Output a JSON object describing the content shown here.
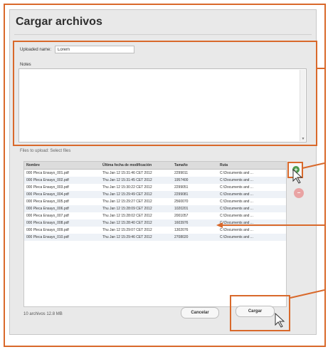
{
  "dialog": {
    "title": "Cargar archivos",
    "upload_label": "Uploaded name:",
    "upload_value": "Lorem",
    "notes_label": "Notes",
    "files_label": "Files to upload: Select files"
  },
  "table": {
    "columns": [
      "Nombre",
      "Última fecha de modificación",
      "Tamaño",
      "Ruta"
    ],
    "rows": [
      [
        "000 Pleca Ensayo_001.pdf",
        "Thu Jan 12 15:31:46 CET 2012",
        "2299011",
        "C:\\Documents and ..."
      ],
      [
        "000 Pleca Ensayo_002.pdf",
        "Thu Jan 12 15:31:45 CET 2012",
        "1957400",
        "C:\\Documents and ..."
      ],
      [
        "000 Pleca Ensayo_003.pdf",
        "Thu Jan 12 15:30:22 CET 2012",
        "2299051",
        "C:\\Documents and ..."
      ],
      [
        "000 Pleca Ensayo_004.pdf",
        "Thu Jan 12 15:29:49 CET 2012",
        "2299081",
        "C:\\Documents and ..."
      ],
      [
        "000 Pleca Ensayo_005.pdf",
        "Thu Jan 12 15:29:27 CET 2012",
        "2560070",
        "C:\\Documents and ..."
      ],
      [
        "000 Pleca Ensayo_006.pdf",
        "Thu Jan 12 15:28:09 CET 2012",
        "1020201",
        "C:\\Documents and ..."
      ],
      [
        "000 Pleca Ensayo_007.pdf",
        "Thu Jan 12 15:28:02 CET 2012",
        "2001057",
        "C:\\Documents and ..."
      ],
      [
        "000 Pleca Ensayo_008.pdf",
        "Thu Jan 12 15:28:40 CET 2012",
        "1603976",
        "C:\\Documents and ..."
      ],
      [
        "000 Pleca Ensayo_009.pdf",
        "Thu Jan 12 15:29:07 CET 2012",
        "1302076",
        "C:\\Documents and ..."
      ],
      [
        "000 Pleca Ensayo_010.pdf",
        "Thu Jan 12 15:29:46 CET 2012",
        "2708020",
        "C:\\Documents and ..."
      ]
    ]
  },
  "footer": {
    "file_count": "10 archivos 12.8 MB",
    "cancel_label": "Cancelar",
    "upload_label": "Cargar"
  },
  "icons": {
    "add": "plus-icon",
    "remove": "minus-icon"
  },
  "colors": {
    "highlight": "#d9692b",
    "add_green": "#4d9a4d",
    "remove_red": "#e9a3a3"
  }
}
